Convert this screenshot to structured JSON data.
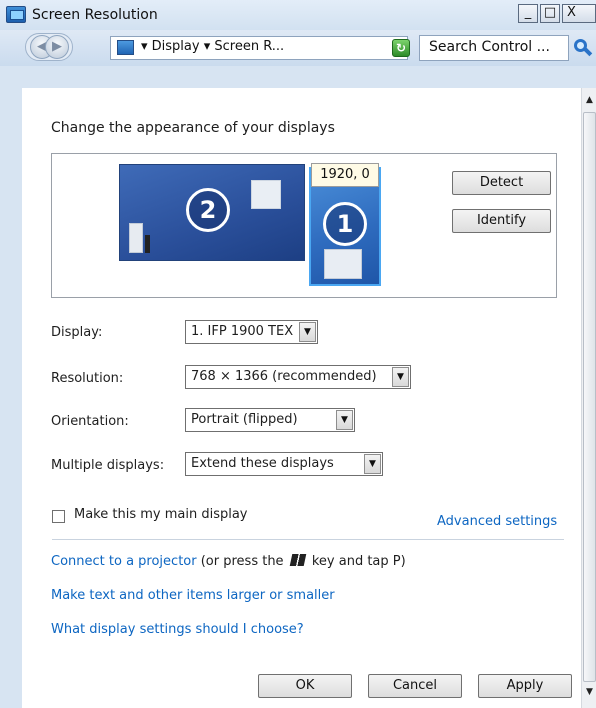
{
  "window": {
    "title": "Screen Resolution",
    "min_glyph": "_",
    "max_glyph": "□",
    "close_glyph": "X"
  },
  "addressbar": {
    "back_glyph": "◀",
    "forward_glyph": "▶",
    "breadcrumb": "▾ Display ▾ Screen R...",
    "dropdown_glyph": "▼",
    "refresh_glyph": "↻",
    "search_placeholder": "Search Control ..."
  },
  "main": {
    "heading": "Change the appearance of your displays",
    "preview": {
      "monitor2_number": "2",
      "monitor1_number": "1",
      "monitor1_position": "1920, 0"
    },
    "detect_label": "Detect",
    "identify_label": "Identify",
    "display": {
      "label": "Display:",
      "value": "1. IFP 1900 TEX"
    },
    "resolution": {
      "label": "Resolution:",
      "value": "768 × 1366 (recommended)"
    },
    "orientation": {
      "label": "Orientation:",
      "value": "Portrait (flipped)"
    },
    "multiple_displays": {
      "label": "Multiple displays:",
      "value": "Extend these displays"
    },
    "main_display_checkbox": {
      "label": "Make this my main display",
      "checked": false
    },
    "advanced_settings": "Advanced settings",
    "projector_link": "Connect to a projector",
    "projector_suffix_1": "(or press the",
    "projector_suffix_2": "key and tap P)",
    "text_size_link": "Make text and other items larger or smaller",
    "help_link": "What display settings should I choose?",
    "ok_label": "OK",
    "cancel_label": "Cancel",
    "apply_label": "Apply"
  },
  "scrollbar": {
    "up_glyph": "▲",
    "down_glyph": "▼"
  }
}
